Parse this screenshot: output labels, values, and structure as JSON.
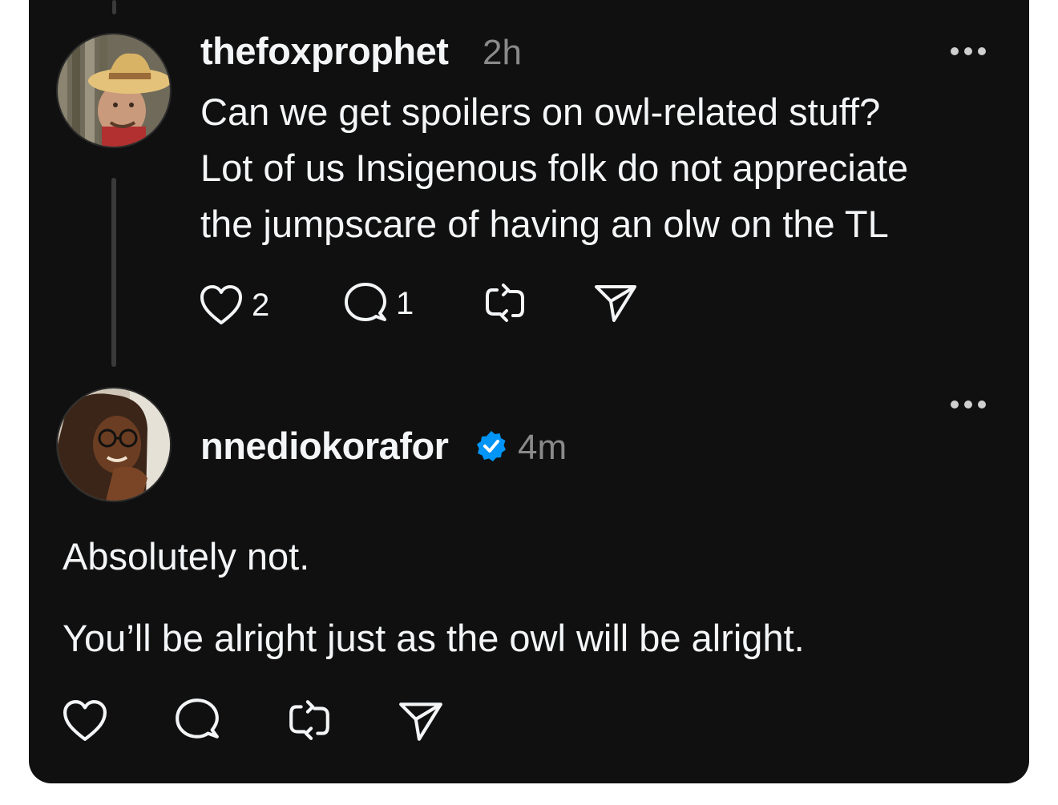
{
  "post1": {
    "username": "thefoxprophet",
    "time": "2h",
    "text_lines": [
      "Can we get spoilers on owl-related stuff?",
      "Lot of us Insigenous folk do not appreciate",
      "the jumpscare of having an olw on the TL"
    ],
    "likes": "2",
    "replies": "1"
  },
  "post2": {
    "username": "nnediokorafor",
    "verified": true,
    "time": "4m",
    "paragraph1": "Absolutely not.",
    "paragraph2": "You’ll be alright just as the owl will be alright."
  },
  "colors": {
    "background": "#101010",
    "text": "#f3f5f7",
    "muted": "#8a8a8a",
    "verified_badge": "#0095f6"
  },
  "icons": [
    "heart-icon",
    "comment-icon",
    "repost-icon",
    "share-icon",
    "more-icon",
    "verified-badge-icon"
  ]
}
